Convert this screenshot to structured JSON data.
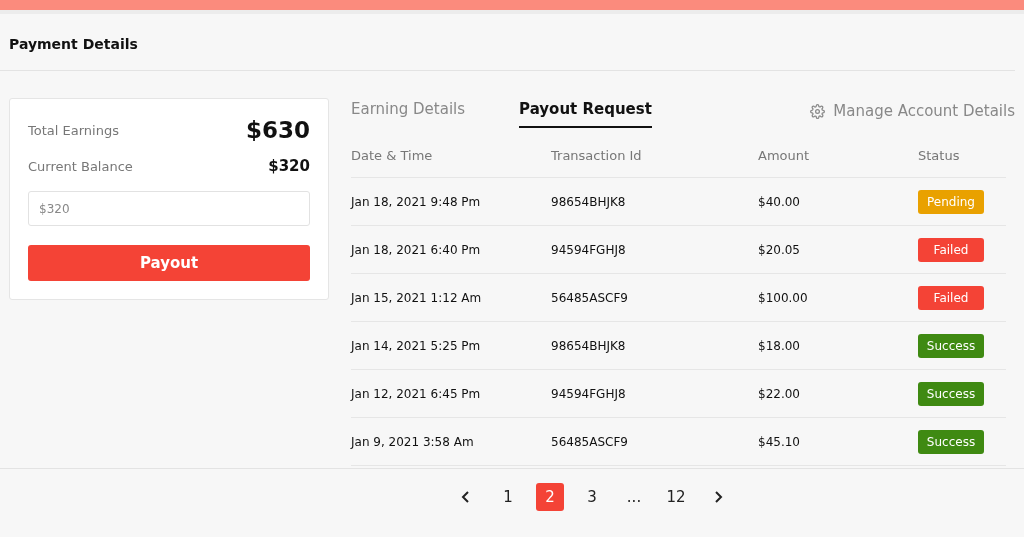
{
  "title": "Payment Details",
  "summary": {
    "total_label": "Total Earnings",
    "total_value": "$630",
    "balance_label": "Current Balance",
    "balance_value": "$320",
    "amount_placeholder": "$320",
    "button": "Payout"
  },
  "tabs": [
    {
      "label": "Earning Details",
      "selected": false
    },
    {
      "label": "Payout Request",
      "selected": true
    }
  ],
  "manage_link": "Manage Account Details",
  "table": {
    "columns": [
      "Date & Time",
      "Transaction Id",
      "Amount",
      "Status"
    ],
    "rows": [
      {
        "date": "Jan 18, 2021 9:48 Pm",
        "id": "98654BHJK8",
        "amount": "$40.00",
        "status": "Pending",
        "color": "#e9a100"
      },
      {
        "date": "Jan 18, 2021 6:40 Pm",
        "id": "94594FGHJ8",
        "amount": "$20.05",
        "status": "Failed",
        "color": "#f44336"
      },
      {
        "date": "Jan 15, 2021 1:12 Am",
        "id": "56485ASCF9",
        "amount": "$100.00",
        "status": "Failed",
        "color": "#f44336"
      },
      {
        "date": "Jan 14, 2021 5:25 Pm",
        "id": "98654BHJK8",
        "amount": "$18.00",
        "status": "Success",
        "color": "#3f8a12"
      },
      {
        "date": "Jan 12, 2021 6:45 Pm",
        "id": "94594FGHJ8",
        "amount": "$22.00",
        "status": "Success",
        "color": "#3f8a12"
      },
      {
        "date": "Jan 9, 2021 3:58 Am",
        "id": "56485ASCF9",
        "amount": "$45.10",
        "status": "Success",
        "color": "#3f8a12"
      }
    ]
  },
  "pagination": [
    {
      "label": "1",
      "selected": false
    },
    {
      "label": "2",
      "selected": true
    },
    {
      "label": "3",
      "selected": false
    },
    {
      "label": "...",
      "selected": false
    },
    {
      "label": "12",
      "selected": false
    }
  ]
}
